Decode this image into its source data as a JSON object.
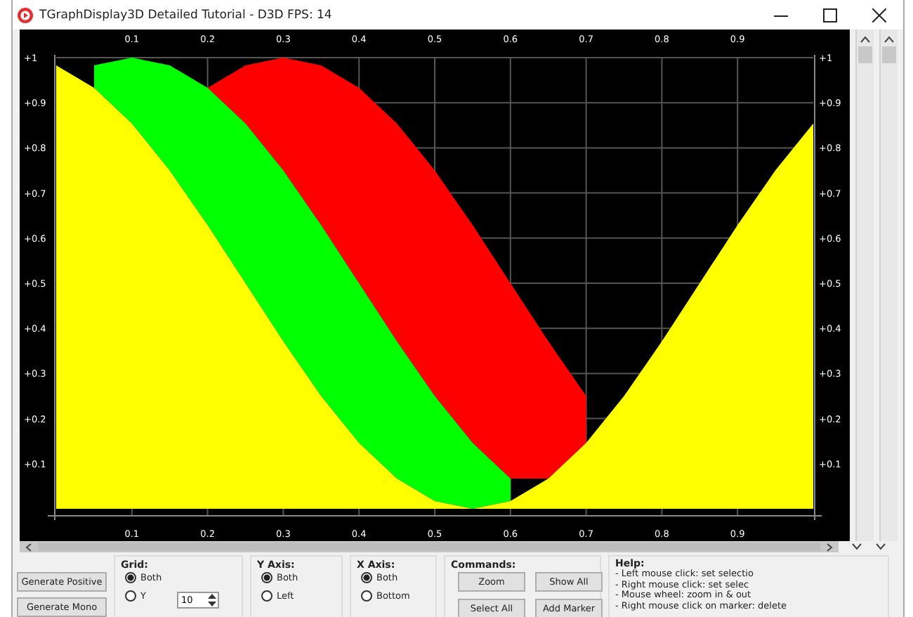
{
  "window": {
    "title": "TGraphDisplay3D Detailed Tutorial - D3D FPS: 14"
  },
  "chart": {
    "chart_data": {
      "type": "area",
      "x": [
        0,
        0.05,
        0.1,
        0.15,
        0.2,
        0.25,
        0.3,
        0.35,
        0.4,
        0.45,
        0.5,
        0.55,
        0.6,
        0.65,
        0.7,
        0.75,
        0.8,
        0.85,
        0.9,
        0.95,
        1
      ],
      "series": [
        {
          "color": "#ff0000",
          "values": [
            null,
            null,
            null,
            null,
            0.933,
            0.983,
            1,
            0.983,
            0.933,
            0.854,
            0.75,
            0.629,
            0.5,
            0.371,
            0.25,
            null,
            null,
            null,
            null,
            null,
            null
          ]
        },
        {
          "color": "#00ff00",
          "values": [
            null,
            0.983,
            1,
            0.983,
            0.933,
            0.854,
            0.75,
            0.629,
            0.5,
            0.371,
            0.25,
            0.146,
            0.067,
            null,
            null,
            null,
            null,
            null,
            null,
            null,
            null
          ]
        },
        {
          "color": "#ffff00",
          "values": [
            0.983,
            0.933,
            0.854,
            0.75,
            0.629,
            0.5,
            0.371,
            0.25,
            0.146,
            0.067,
            0.017,
            0,
            0.017,
            0.067,
            0.146,
            0.25,
            0.371,
            0.5,
            0.629,
            0.75,
            0.854
          ]
        }
      ],
      "xlim": [
        0,
        1
      ],
      "ylim": [
        0,
        1
      ],
      "grid": true,
      "xticks": [
        0.1,
        0.2,
        0.3,
        0.4,
        0.5,
        0.6,
        0.7,
        0.8,
        0.9
      ],
      "yticks": [
        {
          "value": 0.1,
          "label": "+0.1"
        },
        {
          "value": 0.2,
          "label": "+0.2"
        },
        {
          "value": 0.3,
          "label": "+0.3"
        },
        {
          "value": 0.4,
          "label": "+0.4"
        },
        {
          "value": 0.5,
          "label": "+0.5"
        },
        {
          "value": 0.6,
          "label": "+0.6"
        },
        {
          "value": 0.7,
          "label": "+0.7"
        },
        {
          "value": 0.8,
          "label": "+0.8"
        },
        {
          "value": 0.9,
          "label": "+0.9"
        },
        {
          "value": 1,
          "label": "+1"
        }
      ]
    },
    "bottom_axis_labels": [
      "0.1",
      "0.2",
      "0.3",
      "0.4",
      "0.5",
      "0.6",
      "0.7",
      "0.8",
      "0.9"
    ]
  },
  "buttons": [
    "Generate Positive",
    "Generate Mono"
  ],
  "grid": {
    "title": "Grid:",
    "options": [
      {
        "label": "Both",
        "selected": true
      },
      {
        "label": "Y",
        "selected": false
      }
    ],
    "spin_value": "10"
  },
  "y_axis": {
    "title": "Y Axis:",
    "options": [
      {
        "label": "Both",
        "selected": true
      },
      {
        "label": "Left",
        "selected": false
      }
    ]
  },
  "x_axis": {
    "title": "X Axis:",
    "options": [
      {
        "label": "Both",
        "selected": true
      },
      {
        "label": "Bottom",
        "selected": false
      }
    ]
  },
  "commands": {
    "title": "Commands:",
    "buttons": [
      "Zoom",
      "Show All",
      "Select All",
      "Add Marker"
    ]
  },
  "help": {
    "title": "Help:",
    "lines": [
      "- Left mouse click: set selectio",
      "- Right mouse click: set selec",
      "- Mouse wheel: zoom in & out",
      "- Right mouse click on marker: delete"
    ]
  }
}
